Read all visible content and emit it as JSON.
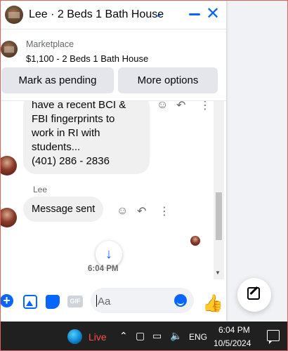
{
  "header": {
    "title": "Lee · 2 Beds 1 Bath House",
    "icons": [
      "chevron-down-icon",
      "minimize-icon",
      "close-icon"
    ]
  },
  "marketplace": {
    "label": "Marketplace",
    "listing": "$1,100 - 2 Beds 1 Bath House",
    "mark_pending": "Mark as pending",
    "more_options": "More options"
  },
  "messages": {
    "bubble1_lines": [
      "have a recent BCI &",
      "FBI fingerprints to",
      "work in RI with",
      "students...",
      "(401) 286 - 2836"
    ],
    "sender": "Lee",
    "bubble2": "Message sent",
    "timestamp": "6:04 PM"
  },
  "composer": {
    "placeholder": "Aa",
    "gif": "GIF"
  },
  "taskbar": {
    "live": "Live",
    "lang": "ENG",
    "time": "6:04 PM",
    "date": "10/5/2024"
  },
  "colors": {
    "accent": "#0866ff",
    "bubble": "#f0f0f0",
    "taskbar": "#202020",
    "live": "#ff4c4c"
  }
}
